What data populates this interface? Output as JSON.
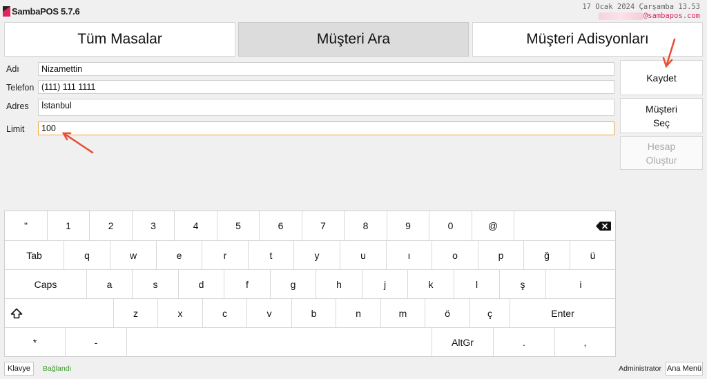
{
  "app": {
    "title": "SambaPOS 5.7.6",
    "brand_color": "#e0245e"
  },
  "header": {
    "datetime": "17 Ocak 2024 Çarşamba 13.53",
    "email_visible": "@sambapos.com"
  },
  "tabs": [
    {
      "label": "Tüm Masalar",
      "active": false
    },
    {
      "label": "Müşteri Ara",
      "active": true
    },
    {
      "label": "Müşteri Adisyonları",
      "active": false
    }
  ],
  "form": {
    "name": {
      "label": "Adı",
      "value": "Nizamettin"
    },
    "phone": {
      "label": "Telefon",
      "value": "(111) 111 1111"
    },
    "address": {
      "label": "Adres",
      "value": "İstanbul"
    },
    "limit": {
      "label": "Limit",
      "value": "100"
    }
  },
  "actions": {
    "save": "Kaydet",
    "select_customer": "Müşteri\nSeç",
    "create_account": "Hesap\nOluştur"
  },
  "keyboard": {
    "row1": [
      "\"",
      "1",
      "2",
      "3",
      "4",
      "5",
      "6",
      "7",
      "8",
      "9",
      "0",
      "@",
      ""
    ],
    "row2": [
      "Tab",
      "q",
      "w",
      "e",
      "r",
      "t",
      "y",
      "u",
      "ı",
      "o",
      "p",
      "ğ",
      "ü"
    ],
    "row3": [
      "Caps",
      "a",
      "s",
      "d",
      "f",
      "g",
      "h",
      "j",
      "k",
      "l",
      "ş",
      "i"
    ],
    "row4": [
      "",
      "z",
      "x",
      "c",
      "v",
      "b",
      "n",
      "m",
      "ö",
      "ç",
      "Enter"
    ],
    "row5": [
      "*",
      "-",
      "",
      "AltGr",
      ".",
      ","
    ],
    "backspace_icon": "backspace-icon",
    "shift_icon": "shift-arrow-icon"
  },
  "footer": {
    "keyboard_button": "Klavye",
    "connection_status": "Bağlandı",
    "connection_color": "#3a9a2a",
    "user": "Administrator",
    "main_menu_button": "Ana Menü"
  },
  "annotation_color": "#e8503a"
}
